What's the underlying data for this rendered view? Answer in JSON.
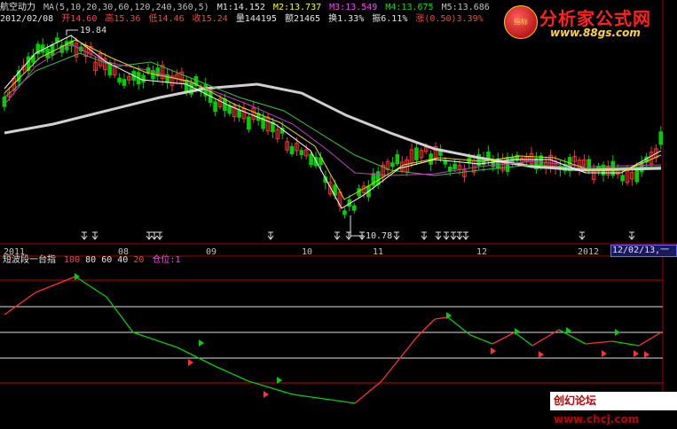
{
  "header": {
    "stock_name": "航空动力",
    "ma_label": "MA(5,10,20,30,60,120,240,360,5)",
    "m1": "M1:14.152",
    "m2": "M2:13.737",
    "m3": "M3:13.549",
    "m4": "M4:13.675",
    "m5": "M5:13.686",
    "date": "2012/02/08",
    "open": "开14.60",
    "high": "高15.36",
    "low": "低14.46",
    "close": "收15.24",
    "volume": "量144195",
    "amount": "额21465",
    "turnover": "换1.33%",
    "amplitude": "振6.11%",
    "change": "涨(0.50)3.39%"
  },
  "price_annotations": {
    "high_mark": "19.84",
    "low_mark": "10.78"
  },
  "time_axis": {
    "labels": [
      "2011",
      "08",
      "09",
      "10",
      "11",
      "12",
      "2012"
    ],
    "cursor_date": "12/02/13,一"
  },
  "indicator": {
    "name": "短波段一台指",
    "levels": [
      "100",
      "80",
      "60",
      "40",
      "20"
    ],
    "position_label": "仓位:1"
  },
  "logo": {
    "badge_text": "指标",
    "brand": "分析家公式网",
    "url": "www.88gs.com"
  },
  "watermark": {
    "text": "创幻论坛 www.chcj.com"
  },
  "colors": {
    "background": "#000000",
    "up_candle": "#ff3030",
    "down_candle": "#00d000",
    "ma_slow": "#d0d0d0",
    "ma_purple": "#c040c0",
    "ma_green": "#40c040",
    "indicator_up": "#ff3030",
    "indicator_down": "#00d000",
    "level_line": "#e0e0e0",
    "level_red": "#c00000"
  }
}
